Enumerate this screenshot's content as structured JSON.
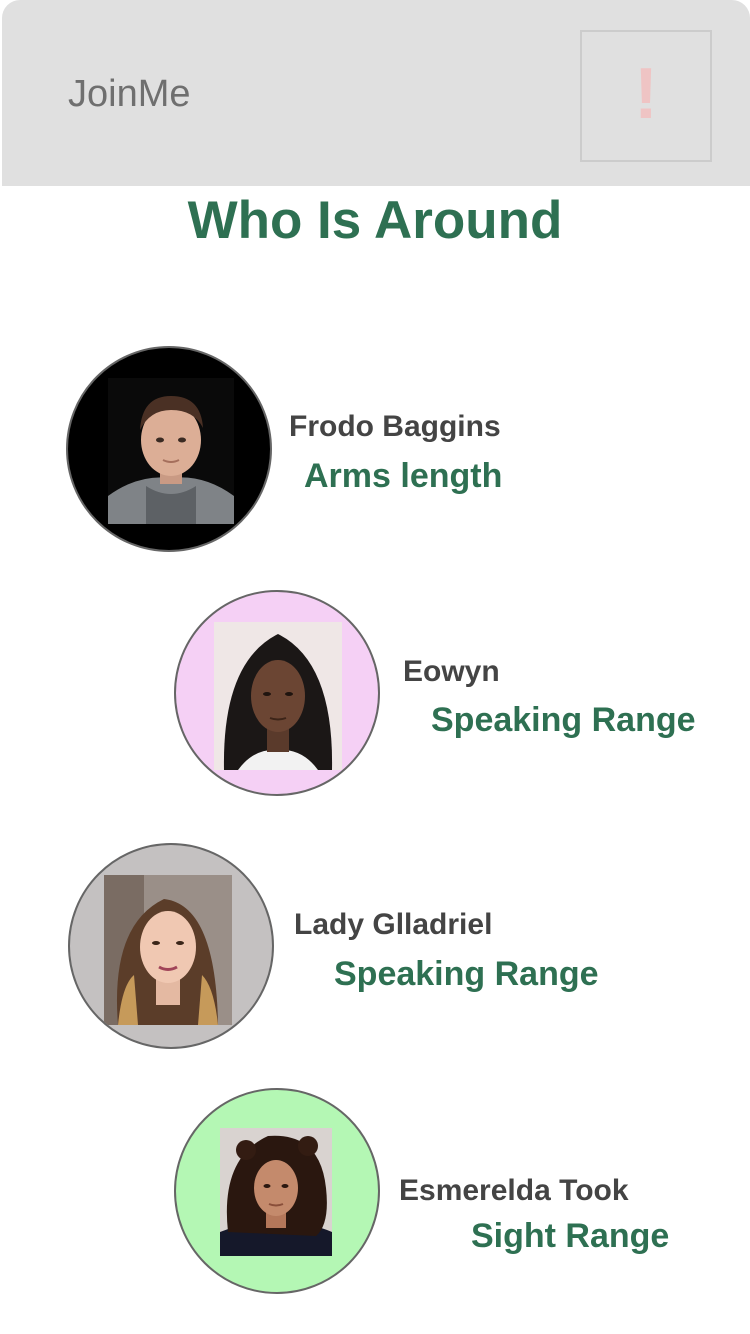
{
  "header": {
    "app_name": "JoinMe",
    "alert_icon": "!"
  },
  "page": {
    "title": "Who Is Around"
  },
  "people": [
    {
      "name": "Frodo Baggins",
      "range": "Arms length",
      "ring_color": "#000000"
    },
    {
      "name": "Eowyn",
      "range": "Speaking Range",
      "ring_color": "#f5d0f5"
    },
    {
      "name": "Lady Glladriel",
      "range": "Speaking Range",
      "ring_color": "#c4c1c1"
    },
    {
      "name": "Esmerelda Took",
      "range": "Sight Range",
      "ring_color": "#b4f7b4"
    }
  ],
  "colors": {
    "accent_green": "#2e7052",
    "header_bg": "#e0e0e0",
    "alert_pink": "#efc4c4"
  }
}
